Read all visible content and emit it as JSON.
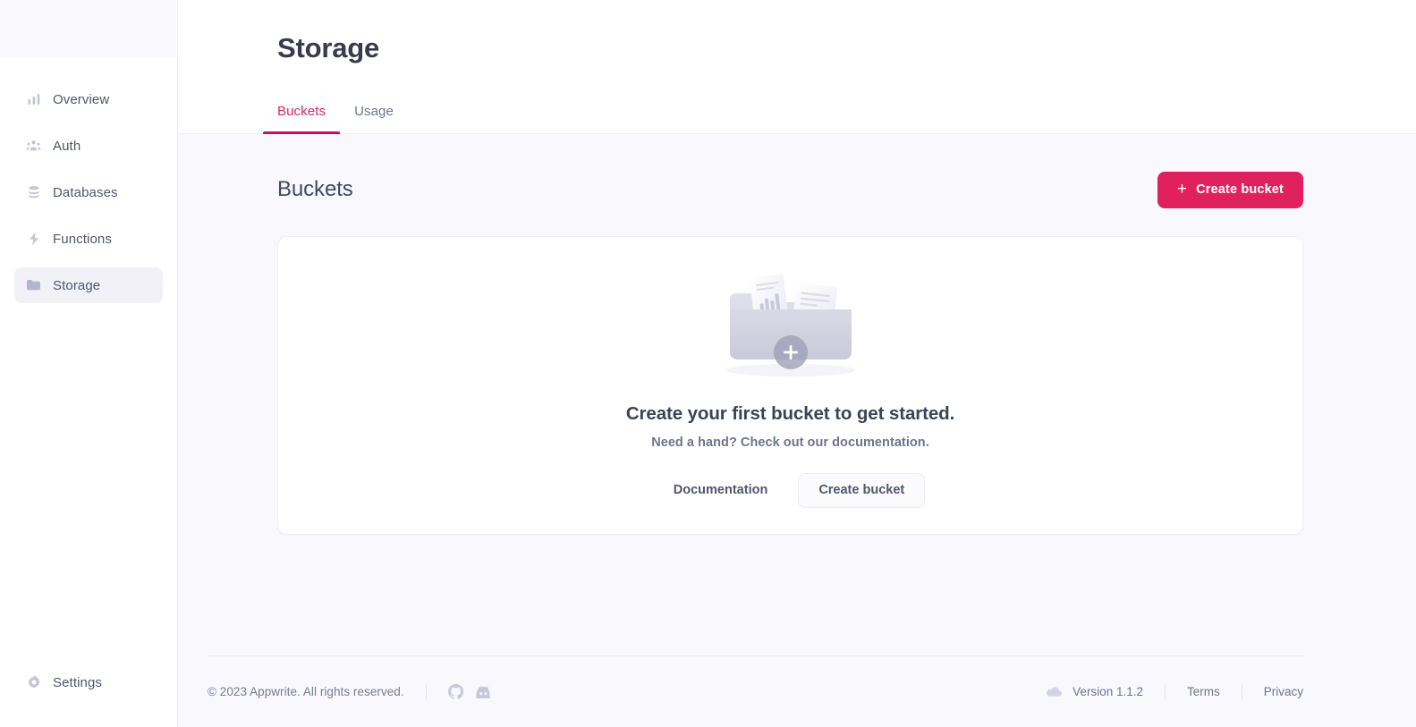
{
  "sidebar": {
    "items": [
      {
        "label": "Overview",
        "icon": "bar-chart-icon",
        "active": false
      },
      {
        "label": "Auth",
        "icon": "users-icon",
        "active": false
      },
      {
        "label": "Databases",
        "icon": "database-icon",
        "active": false
      },
      {
        "label": "Functions",
        "icon": "lightning-icon",
        "active": false
      },
      {
        "label": "Storage",
        "icon": "folder-icon",
        "active": true
      }
    ],
    "bottom": {
      "label": "Settings",
      "icon": "gear-icon"
    }
  },
  "header": {
    "title": "Storage",
    "tabs": [
      {
        "label": "Buckets",
        "active": true
      },
      {
        "label": "Usage",
        "active": false
      }
    ]
  },
  "main": {
    "section_title": "Buckets",
    "create_button": {
      "label": "Create bucket",
      "icon": "plus-icon"
    },
    "empty_state": {
      "illustration": "folder-with-documents-illustration",
      "title": "Create your first bucket to get started.",
      "subtitle": "Need a hand? Check out our documentation.",
      "documentation_label": "Documentation",
      "create_label": "Create bucket"
    }
  },
  "footer": {
    "copyright": "© 2023 Appwrite. All rights reserved.",
    "social": [
      {
        "name": "github-icon"
      },
      {
        "name": "discord-icon"
      }
    ],
    "version": "Version 1.1.2",
    "version_icon": "cloud-icon",
    "terms": "Terms",
    "privacy": "Privacy"
  },
  "colors": {
    "accent": "#e0215e",
    "accent_underline": "#cc0f5c",
    "page_bg": "#f9f8fd",
    "sidebar_active": "#f2f1f8",
    "text": "#373b4d",
    "muted": "#6f7489"
  }
}
